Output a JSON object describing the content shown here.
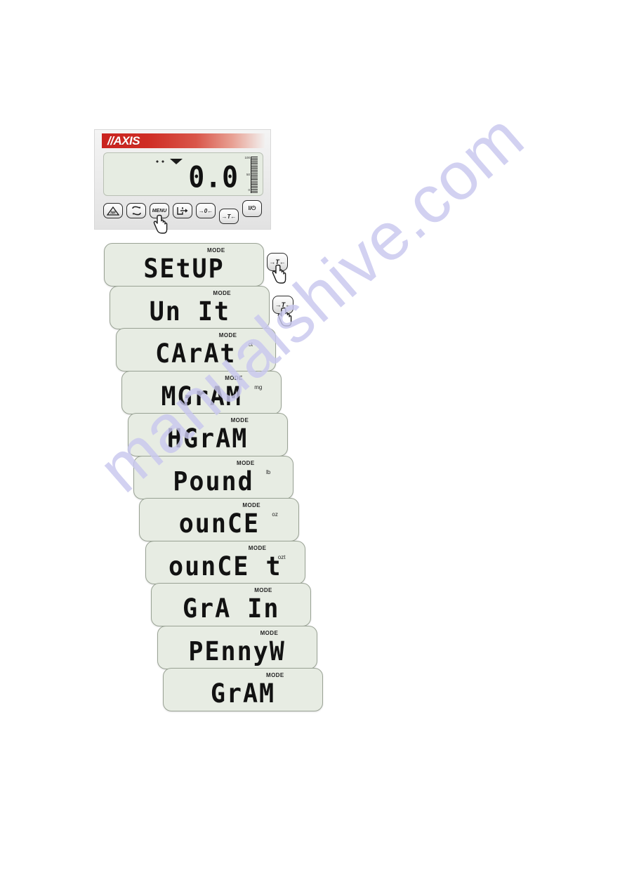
{
  "device": {
    "brand": "//AXIS",
    "display_value": "0.0",
    "bargraph": {
      "top": "100",
      "mid": "50",
      "bottom": "0"
    },
    "keys": [
      {
        "name": "nr-key",
        "label": "NR",
        "icon": "triangle-nr-icon"
      },
      {
        "name": "swap-key",
        "label": "",
        "icon": "swap-arrows-icon"
      },
      {
        "name": "menu-key",
        "label": "MENU",
        "icon": "menu-text-icon"
      },
      {
        "name": "print-key",
        "label": "",
        "icon": "print-arrow-icon"
      },
      {
        "name": "zero-key",
        "label": "→0←",
        "icon": "zero-icon"
      },
      {
        "name": "tare-key",
        "label": "→T←",
        "icon": "tare-icon"
      },
      {
        "name": "power-key",
        "label": "I/⏻",
        "icon": "power-icon"
      }
    ]
  },
  "steps": [
    {
      "text": "SEtUP",
      "mode": "MODE",
      "unit": "",
      "key": "→T←",
      "has_key": true,
      "has_hand": true
    },
    {
      "text": "Un It",
      "mode": "MODE",
      "unit": "",
      "key": "→T←",
      "has_key": true,
      "has_hand": true
    },
    {
      "text": "CArAt",
      "mode": "MODE",
      "unit": "ct",
      "key": "",
      "has_key": false,
      "has_hand": false
    },
    {
      "text": "MGrAM",
      "mode": "MODE",
      "unit": "mg",
      "key": "",
      "has_key": false,
      "has_hand": false
    },
    {
      "text": "HGrAM",
      "mode": "MODE",
      "unit": "",
      "key": "",
      "has_key": false,
      "has_hand": false
    },
    {
      "text": "Pound",
      "mode": "MODE",
      "unit": "lb",
      "key": "",
      "has_key": false,
      "has_hand": false
    },
    {
      "text": "ounCE",
      "mode": "MODE",
      "unit": "oz",
      "key": "",
      "has_key": false,
      "has_hand": false
    },
    {
      "text": "ounCE t",
      "mode": "MODE",
      "unit": "ozt",
      "key": "",
      "has_key": false,
      "has_hand": false
    },
    {
      "text": "GrA In",
      "mode": "MODE",
      "unit": "",
      "key": "",
      "has_key": false,
      "has_hand": false
    },
    {
      "text": "PEnnyW",
      "mode": "MODE",
      "unit": "",
      "key": "",
      "has_key": false,
      "has_hand": false
    },
    {
      "text": "GrAM",
      "mode": "MODE",
      "unit": "",
      "key": "",
      "has_key": false,
      "has_hand": false
    }
  ],
  "watermark": {
    "text": "manualshive.com",
    "color": "#c9c8ef"
  }
}
